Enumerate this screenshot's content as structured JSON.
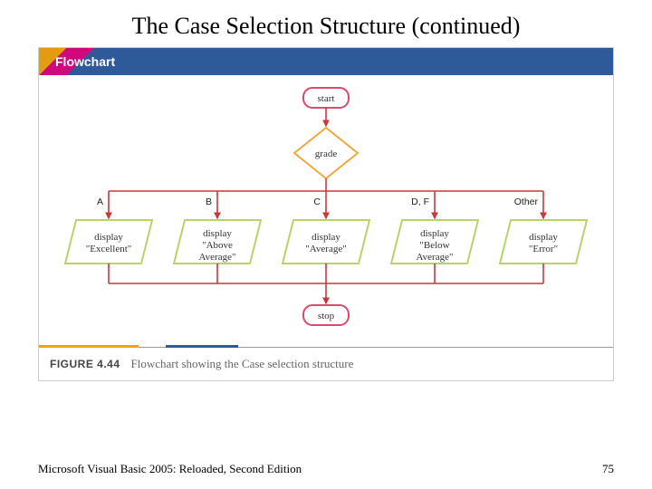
{
  "title": "The Case Selection Structure (continued)",
  "banner": "Flowchart",
  "figure": {
    "label": "FIGURE 4.44",
    "caption": "Flowchart showing the Case selection structure"
  },
  "nodes": {
    "start": "start",
    "decision": "grade",
    "stop": "stop"
  },
  "cases": [
    {
      "label": "A",
      "line1": "display",
      "line2": "\"Excellent\"",
      "line3": ""
    },
    {
      "label": "B",
      "line1": "display",
      "line2": "\"Above",
      "line3": "Average\""
    },
    {
      "label": "C",
      "line1": "display",
      "line2": "\"Average\"",
      "line3": ""
    },
    {
      "label": "D, F",
      "line1": "display",
      "line2": "\"Below",
      "line3": "Average\""
    },
    {
      "label": "Other",
      "line1": "display",
      "line2": "\"Error\"",
      "line3": ""
    }
  ],
  "footer": {
    "left": "Microsoft Visual Basic 2005: Reloaded, Second Edition",
    "right": "75"
  },
  "colors": {
    "terminal": "#d94c6a",
    "decision": "#f2a73d",
    "process": "#b9d36a",
    "arrow": "#c83a3a"
  }
}
